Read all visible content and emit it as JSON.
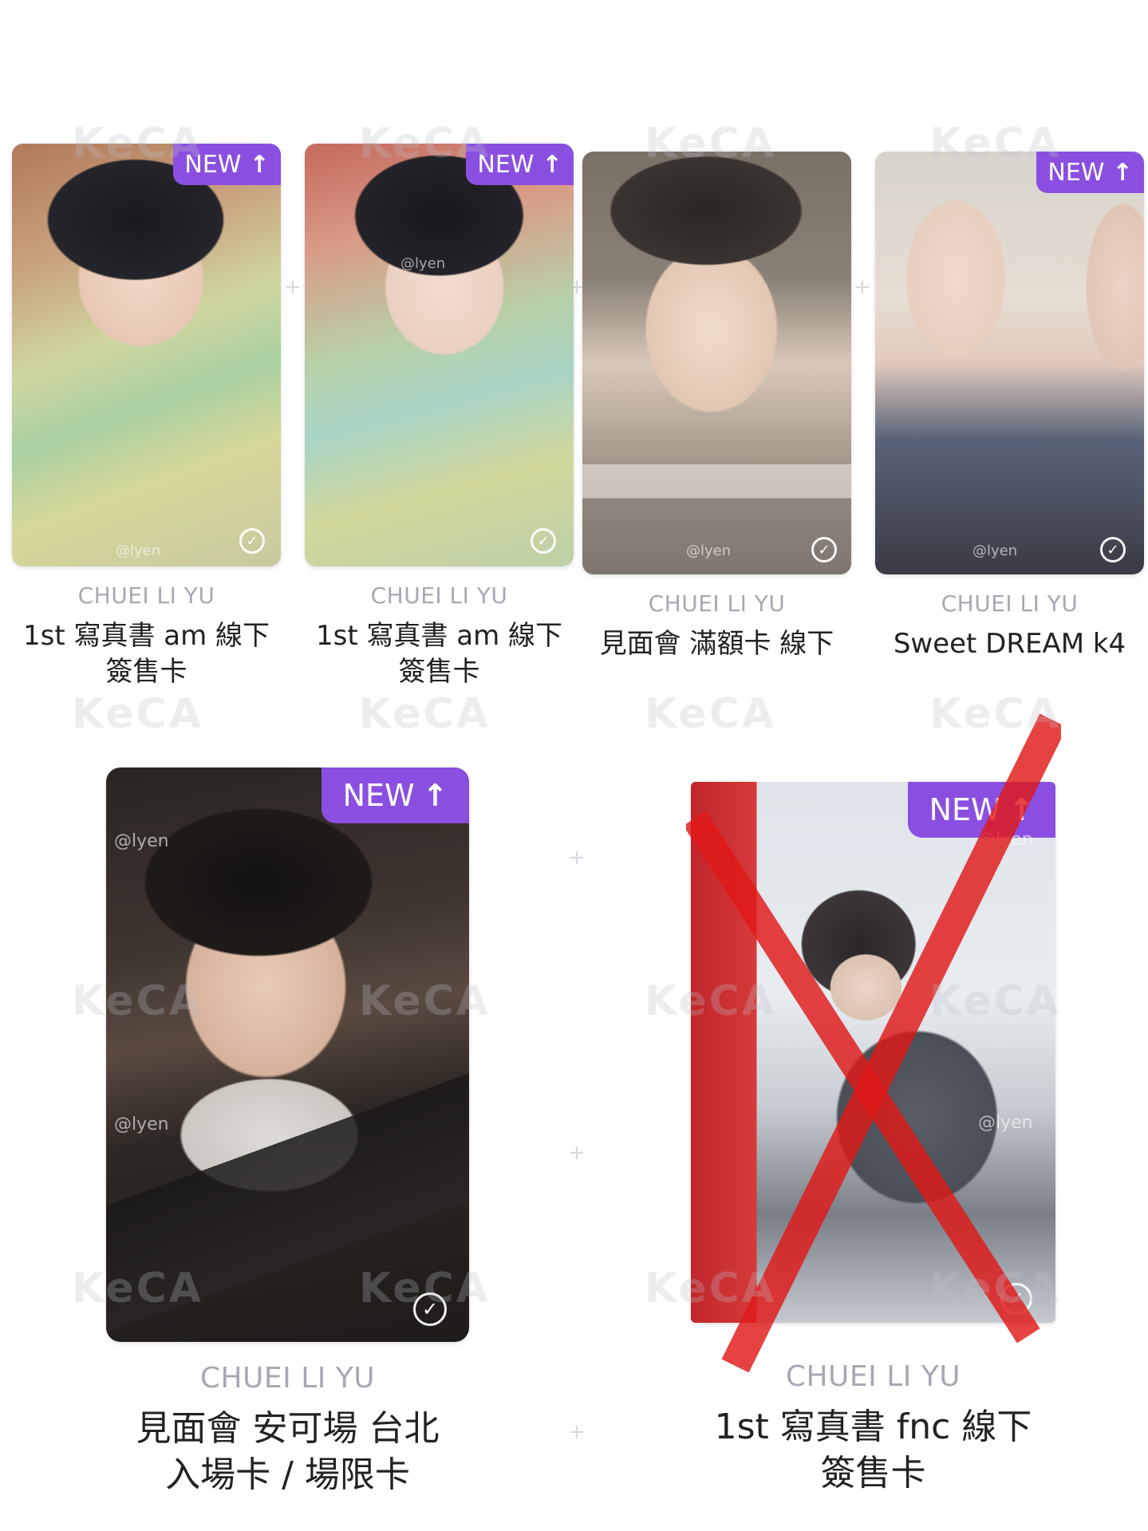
{
  "watermark": "KeCA",
  "accent_color": "#8a4fe0",
  "cards": [
    {
      "artist": "CHUEI LI YU",
      "title": "1st 寫真書 am 線下\n簽售卡",
      "badge": "NEW",
      "selected": true,
      "crossed_out": false,
      "handle": "@lyen"
    },
    {
      "artist": "CHUEI LI YU",
      "title": "1st 寫真書 am 線下\n簽售卡",
      "badge": "NEW",
      "selected": true,
      "crossed_out": false,
      "handle": "@lyen"
    },
    {
      "artist": "CHUEI LI YU",
      "title": "見面會 滿額卡 線下",
      "badge": "",
      "selected": true,
      "crossed_out": false,
      "handle": "@lyen"
    },
    {
      "artist": "CHUEI LI YU",
      "title": "Sweet DREAM k4",
      "badge": "NEW",
      "selected": true,
      "crossed_out": false,
      "handle": "@lyen"
    },
    {
      "artist": "CHUEI LI YU",
      "title": "見面會 安可場 台北\n入場卡 / 場限卡",
      "badge": "NEW",
      "selected": true,
      "crossed_out": false,
      "handle": "@lyen"
    },
    {
      "artist": "CHUEI LI YU",
      "title": "1st 寫真書 fnc 線下\n簽售卡",
      "badge": "NEW",
      "selected": true,
      "crossed_out": true,
      "handle": "@lyen"
    }
  ]
}
